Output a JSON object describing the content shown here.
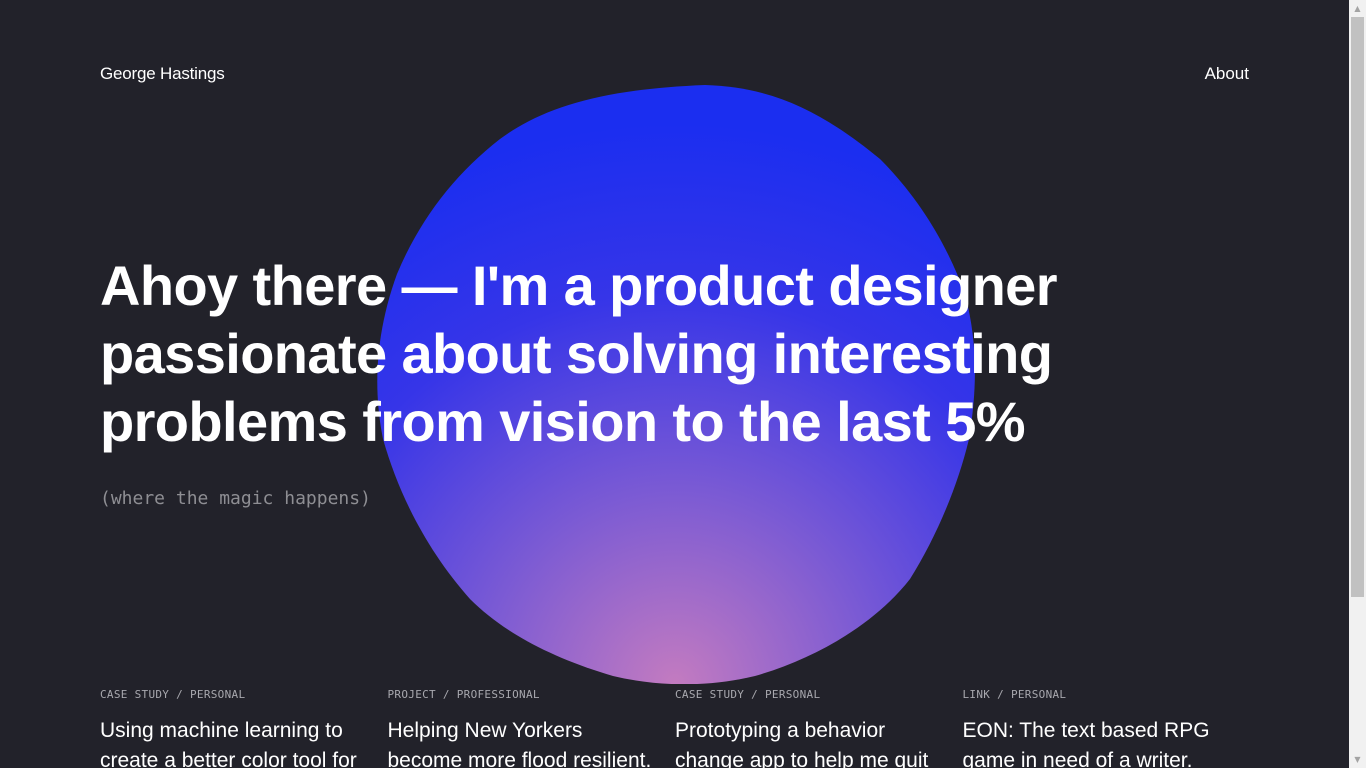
{
  "header": {
    "brand": "George Hastings",
    "nav": {
      "about": "About"
    }
  },
  "hero": {
    "lines": [
      "Ahoy there — I'm a product designer",
      "passionate about solving interesting",
      "problems from vision to the last 5%"
    ],
    "subtitle": "(where the magic happens)"
  },
  "cards": [
    {
      "meta": "CASE STUDY / PERSONAL",
      "title": "Using machine learning to create a better color tool for"
    },
    {
      "meta": "PROJECT / PROFESSIONAL",
      "title": "Helping New Yorkers become more flood resilient."
    },
    {
      "meta": "CASE STUDY / PERSONAL",
      "title": "Prototyping a behavior change app to help me quit"
    },
    {
      "meta": "LINK / PERSONAL",
      "title": "EON: The text based RPG game in need of a writer."
    }
  ],
  "colors": {
    "background": "#22222a",
    "blob_top": "#1b2ef0",
    "blob_bottom": "#c37bc0",
    "text": "#ffffff",
    "muted": "#8e8e93"
  }
}
